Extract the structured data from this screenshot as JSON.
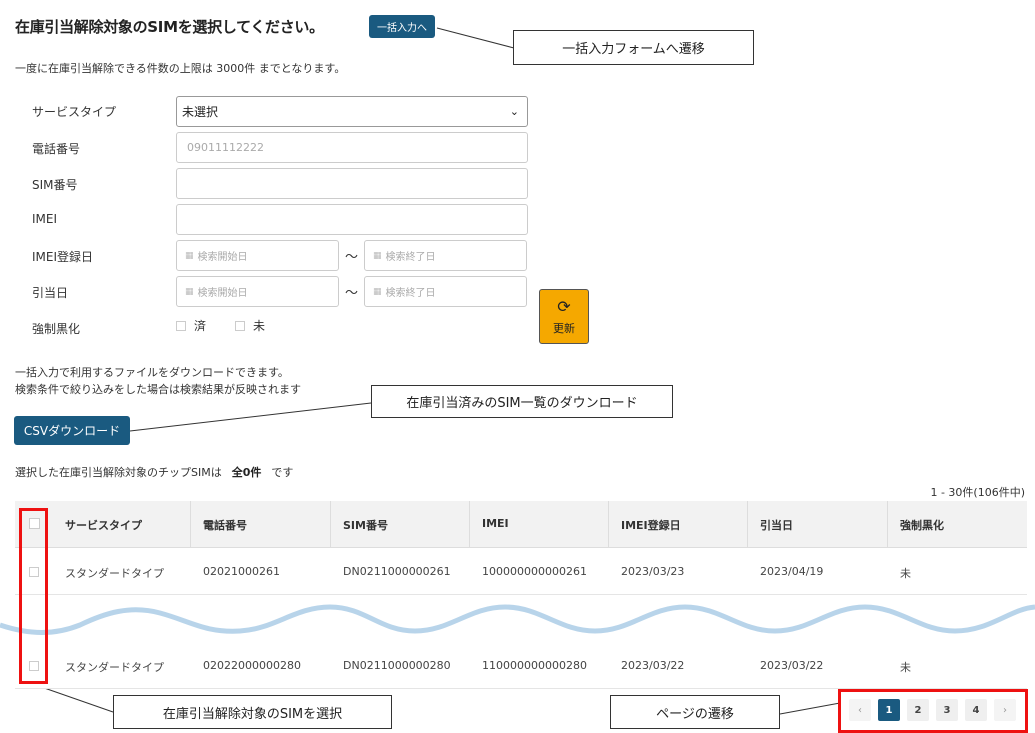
{
  "header": {
    "title": "在庫引当解除対象のSIMを選択してください。",
    "bulk_button": "一括入力へ",
    "limit_note": "一度に在庫引当解除できる件数の上限は 3000件 までとなります。"
  },
  "callouts": {
    "bulk_form": "一括入力フォームへ遷移",
    "csv_download": "在庫引当済みのSIM一覧のダウンロード",
    "select_sim": "在庫引当解除対象のSIMを選択",
    "page_nav": "ページの遷移"
  },
  "form": {
    "service_type_label": "サービスタイプ",
    "service_type_value": "未選択",
    "phone_label": "電話番号",
    "phone_placeholder": "09011112222",
    "sim_label": "SIM番号",
    "imei_label": "IMEI",
    "imei_date_label": "IMEI登録日",
    "assign_date_label": "引当日",
    "date_start_placeholder": "検索開始日",
    "date_end_placeholder": "検索終了日",
    "tilde": "〜",
    "forced_black_label": "強制黒化",
    "forced_done": "済",
    "forced_not": "未",
    "refresh_button": "更新"
  },
  "download": {
    "info_line1": "一括入力で利用するファイルをダウンロードできます。",
    "info_line2": "検索条件で絞り込みをした場合は検索結果が反映されます",
    "csv_button": "CSVダウンロード"
  },
  "selection": {
    "prefix": "選択した在庫引当解除対象のチップSIMは",
    "count": "全0件",
    "suffix": "です"
  },
  "table": {
    "range": "1 - 30件(106件中)",
    "headers": [
      "サービスタイプ",
      "電話番号",
      "SIM番号",
      "IMEI",
      "IMEI登録日",
      "引当日",
      "強制黒化"
    ],
    "rows": [
      [
        "スタンダードタイプ",
        "02021000261",
        "DN0211000000261",
        "100000000000261",
        "2023/03/23",
        "2023/04/19",
        "未"
      ],
      [
        "スタンダードタイプ",
        "02022000000280",
        "DN0211000000280",
        "110000000000280",
        "2023/03/22",
        "2023/03/22",
        "未"
      ]
    ]
  },
  "pagination": {
    "prev": "‹",
    "pages": [
      "1",
      "2",
      "3",
      "4"
    ],
    "next": "›",
    "current": "1"
  },
  "colors": {
    "primary": "#1a5a80",
    "refresh": "#f5a800",
    "highlight": "#e11111",
    "wave": "#b8d4ea"
  }
}
